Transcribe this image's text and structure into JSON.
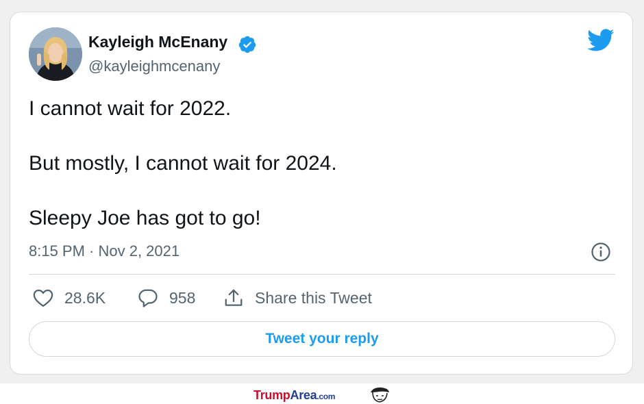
{
  "tweet": {
    "author": {
      "name": "Kayleigh McEnany",
      "handle": "@kayleighmcenany",
      "verified": true,
      "avatar_icon": "profile-photo"
    },
    "text_lines": [
      "I cannot wait for 2022.",
      "But mostly, I cannot wait for 2024.",
      "Sleepy Joe has got to go!"
    ],
    "timestamp": "8:15 PM · Nov 2, 2021",
    "actions": {
      "likes": "28.6K",
      "replies": "958",
      "share_label": "Share this Tweet"
    },
    "reply_button_label": "Tweet your reply"
  },
  "icons": {
    "logo": "twitter-bird-icon",
    "verified": "verified-badge-icon",
    "info": "info-icon",
    "like": "heart-icon",
    "reply": "speech-bubble-icon",
    "share": "share-icon"
  },
  "watermark": {
    "part1": "Trump",
    "part2": "Area",
    "part3": ".com"
  },
  "colors": {
    "accent": "#1d9bf0",
    "text_primary": "#0f1419",
    "text_secondary": "#536471",
    "border": "#cfd9de",
    "watermark_red": "#c8102e",
    "watermark_blue": "#1f3f95"
  }
}
